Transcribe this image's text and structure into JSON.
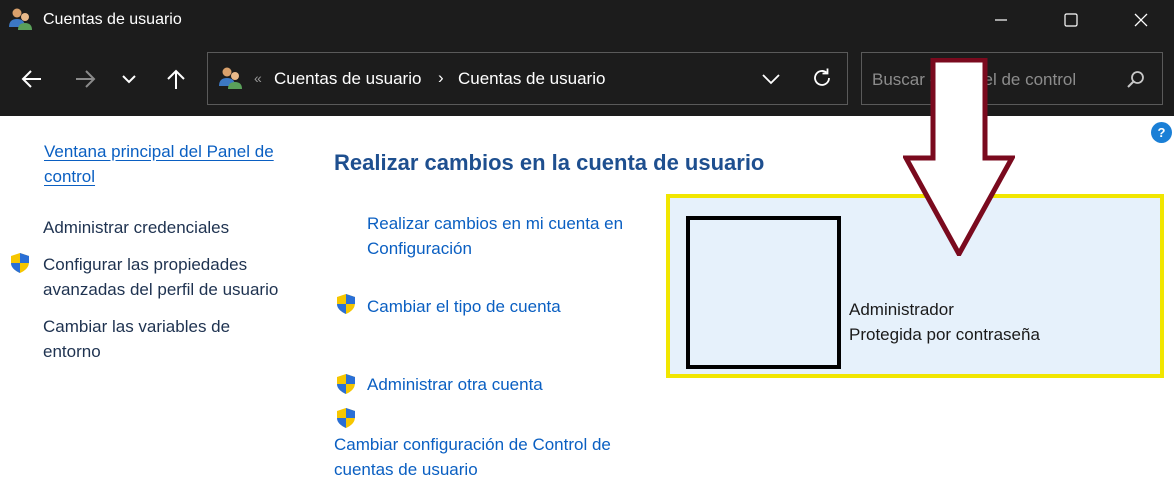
{
  "window": {
    "title": "Cuentas de usuario",
    "icon": "users-icon",
    "controls": [
      "minimize-icon",
      "maximize-icon",
      "close-icon"
    ]
  },
  "nav": {
    "buttons": [
      "back-icon",
      "forward-icon",
      "recent-locations-icon",
      "up-icon"
    ]
  },
  "address": {
    "overflow": "«",
    "crumbs": [
      "Cuentas de usuario",
      "Cuentas de usuario"
    ],
    "separator": "›"
  },
  "search": {
    "placeholder": "Buscar en Panel de control"
  },
  "sidebar": {
    "home_link": "Ventana principal del Panel de control",
    "items": [
      {
        "label": "Administrar credenciales",
        "shield": false
      },
      {
        "label": "Configurar las propiedades avanzadas del perfil de usuario",
        "shield": true
      },
      {
        "label": "Cambiar las variables de entorno",
        "shield": false
      }
    ]
  },
  "main": {
    "title": "Realizar cambios en la cuenta de usuario",
    "tasks": [
      {
        "label": "Realizar cambios en mi cuenta en Configuración",
        "shield": false
      },
      {
        "label": "Cambiar el tipo de cuenta",
        "shield": true
      },
      {
        "label": "Administrar otra cuenta",
        "shield": true
      },
      {
        "label": "Cambiar configuración de Control de cuentas de usuario",
        "shield": true
      }
    ]
  },
  "account": {
    "name": "Administrador",
    "status": "Protegida por contraseña"
  },
  "colors": {
    "titlebar": "#1c1c1c",
    "link": "#0a5fc2",
    "heading": "#1e4f8f",
    "highlight_border": "#f1e600",
    "annotation_arrow": "#7a0a1e",
    "panel_bg": "#e6f1fb"
  }
}
